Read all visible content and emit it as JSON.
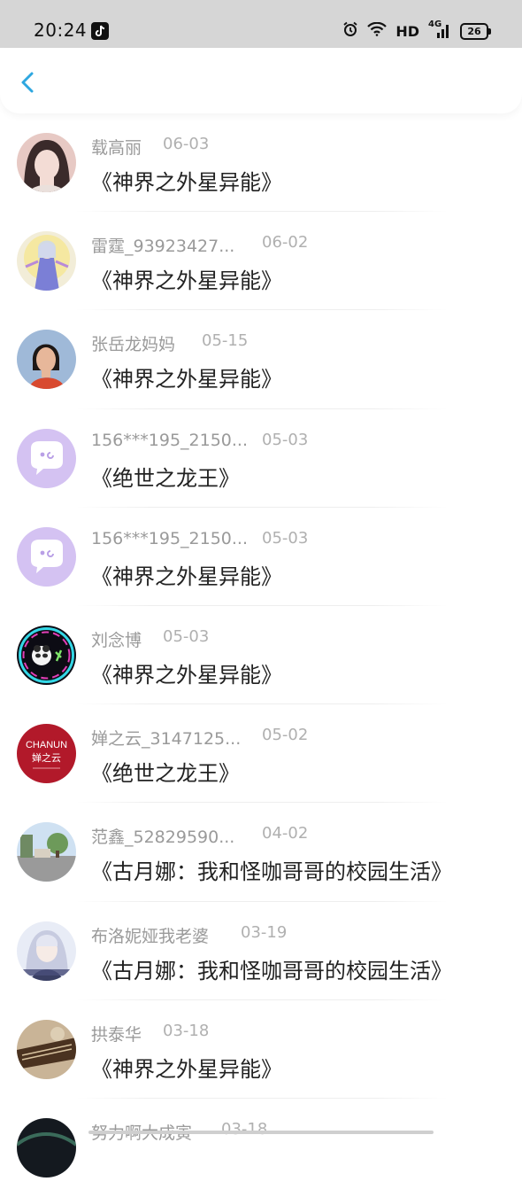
{
  "status_bar": {
    "time": "20:24",
    "network": "HD",
    "signal": "4G",
    "battery": "26",
    "icons": [
      "tiktok-icon",
      "alarm-icon",
      "wifi-icon",
      "signal-icon",
      "battery-icon"
    ]
  },
  "nav": {
    "back_icon": "chevron-left-icon",
    "accent": "#2ea7e0"
  },
  "items": [
    {
      "name": "载高丽",
      "date": "06-03",
      "book": "《神界之外星异能》",
      "avatar": "photo-girl"
    },
    {
      "name": "雷霆_93923427...",
      "date": "06-02",
      "book": "《神界之外星异能》",
      "avatar": "anime-character"
    },
    {
      "name": "张岳龙妈妈",
      "date": "05-15",
      "book": "《神界之外星异能》",
      "avatar": "photo-portrait"
    },
    {
      "name": "156***195_2150...",
      "date": "05-03",
      "book": "《绝世之龙王》",
      "avatar": "default-chat-bubble"
    },
    {
      "name": "156***195_2150...",
      "date": "05-03",
      "book": "《神界之外星异能》",
      "avatar": "default-chat-bubble"
    },
    {
      "name": "刘念博",
      "date": "05-03",
      "book": "《神界之外星异能》",
      "avatar": "neon-panda"
    },
    {
      "name": "婵之云_3147125...",
      "date": "05-02",
      "book": "《绝世之龙王》",
      "avatar": "chanun-logo",
      "avatar_text": "CHANUN",
      "avatar_subtext": "婵之云"
    },
    {
      "name": "范鑫_52829590...",
      "date": "04-02",
      "book": "《古月娜：我和怪咖哥哥的校园生活》",
      "avatar": "photo-street"
    },
    {
      "name": "布洛妮娅我老婆",
      "date": "03-19",
      "book": "《古月娜：我和怪咖哥哥的校园生活》",
      "avatar": "anime-girl"
    },
    {
      "name": "拱泰华",
      "date": "03-18",
      "book": "《神界之外星异能》",
      "avatar": "photo-instrument"
    },
    {
      "name": "努力啊大成寅",
      "date": "03-18",
      "book": "",
      "avatar": "photo-dark"
    }
  ]
}
